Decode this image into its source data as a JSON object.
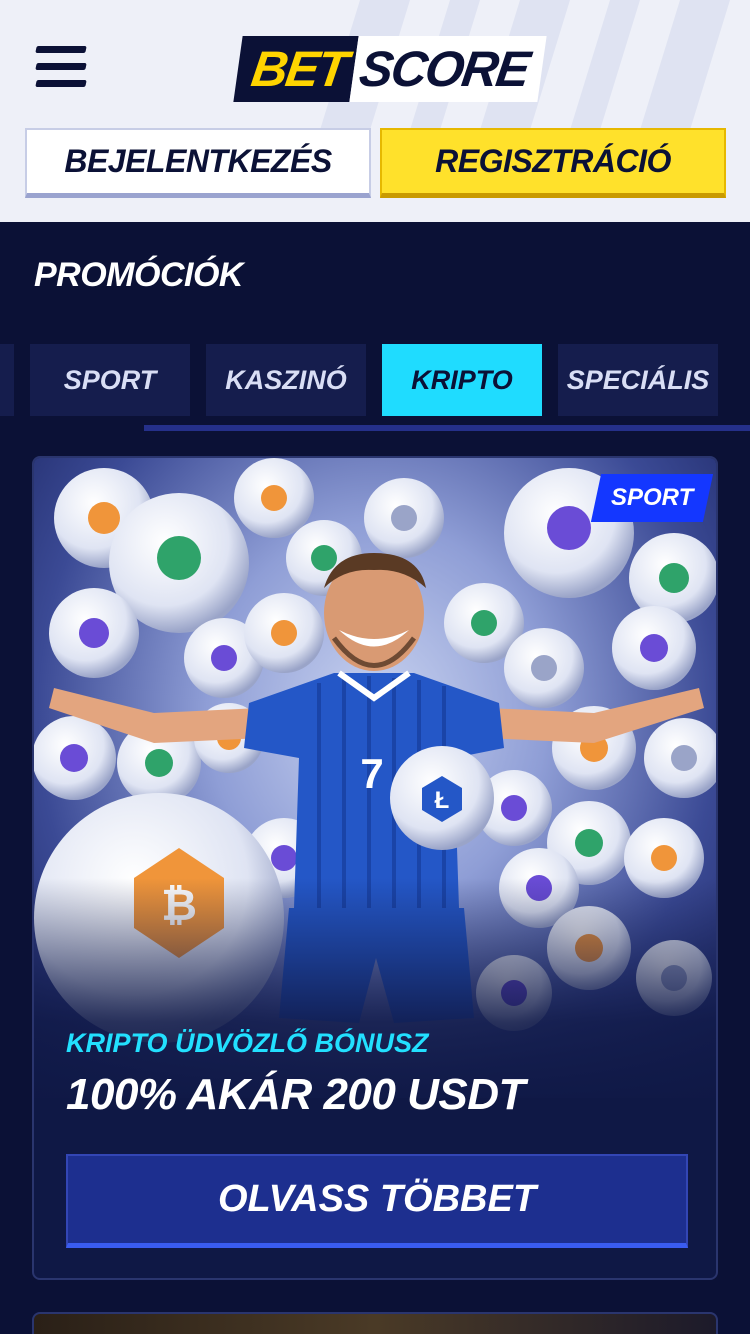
{
  "header": {
    "logo": {
      "part1": "BET",
      "part2": "SCORE"
    },
    "menu_icon": "hamburger-menu-icon",
    "login_label": "BEJELENTKEZÉS",
    "register_label": "REGISZTRÁCIÓ"
  },
  "page": {
    "title": "PROMÓCIÓK"
  },
  "tabs": [
    {
      "label": "SPORT",
      "active": false
    },
    {
      "label": "KASZINÓ",
      "active": false
    },
    {
      "label": "KRIPTO",
      "active": true
    },
    {
      "label": "SPECIÁLIS",
      "active": false
    }
  ],
  "promo": {
    "badge": "SPORT",
    "subtitle": "KRIPTO ÜDVÖZLŐ BÓNUSZ",
    "title": "100% AKÁR 200 USDT",
    "button_label": "OLVASS TÖBBET",
    "image": "player-with-crypto-footballs"
  },
  "colors": {
    "background": "#0b1136",
    "header_bg": "#eef0f8",
    "accent_cyan": "#1fdcff",
    "accent_yellow": "#ffe12b",
    "badge_blue": "#1437ff"
  }
}
